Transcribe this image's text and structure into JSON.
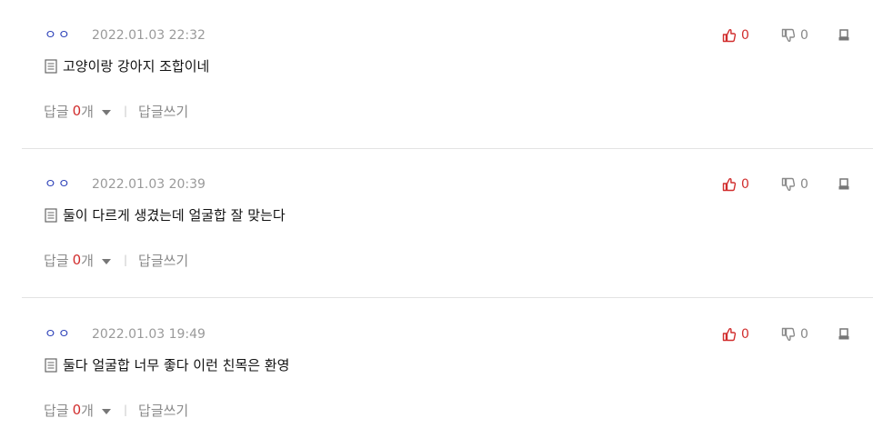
{
  "comments": [
    {
      "author": "ㅇㅇ",
      "date": "2022.01.03 22:32",
      "text": "고양이랑 강아지 조합이네",
      "likes": "0",
      "dislikes": "0",
      "reply_label": "답글",
      "reply_count": "0",
      "reply_unit": "개",
      "reply_write": "답글쓰기"
    },
    {
      "author": "ㅇㅇ",
      "date": "2022.01.03 20:39",
      "text": "둘이 다르게 생겼는데 얼굴합 잘 맞는다",
      "likes": "0",
      "dislikes": "0",
      "reply_label": "답글",
      "reply_count": "0",
      "reply_unit": "개",
      "reply_write": "답글쓰기"
    },
    {
      "author": "ㅇㅇ",
      "date": "2022.01.03 19:49",
      "text": "둘다 얼굴합 너무 좋다 이런 친목은 환영",
      "likes": "0",
      "dislikes": "0",
      "reply_label": "답글",
      "reply_count": "0",
      "reply_unit": "개",
      "reply_write": "답글쓰기"
    }
  ],
  "icons": {
    "like": "thumbs-up-icon",
    "dislike": "thumbs-down-icon",
    "report": "report-icon",
    "memo": "memo-icon",
    "expand": "caret-down-icon"
  },
  "colors": {
    "author": "#2a3fb8",
    "like": "#d12d2d",
    "reply_count": "#d12d2d",
    "muted": "#8a8a8a"
  }
}
